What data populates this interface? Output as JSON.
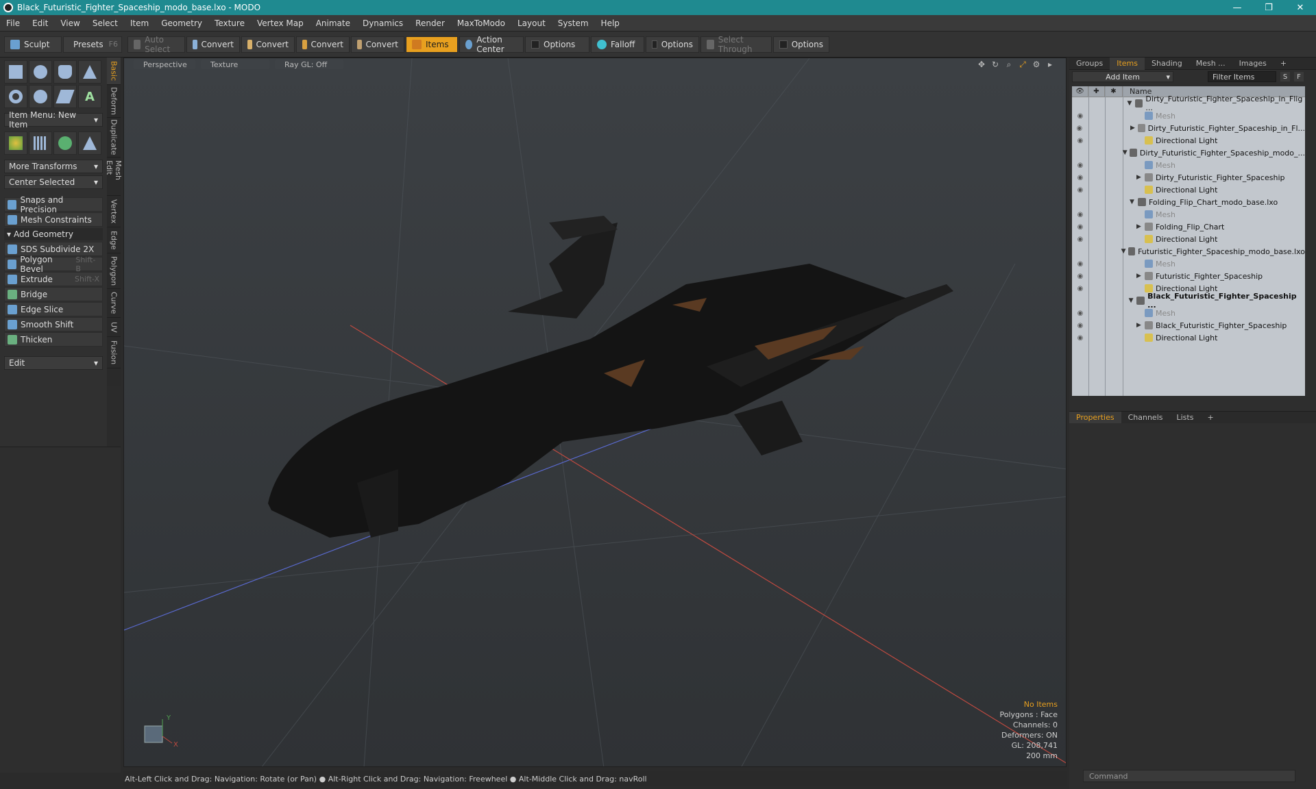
{
  "window": {
    "title": "Black_Futuristic_Fighter_Spaceship_modo_base.lxo - MODO",
    "minimize": "—",
    "maximize": "❐",
    "close": "✕"
  },
  "menu": [
    "File",
    "Edit",
    "View",
    "Select",
    "Item",
    "Geometry",
    "Texture",
    "Vertex Map",
    "Animate",
    "Dynamics",
    "Render",
    "MaxToModo",
    "Layout",
    "System",
    "Help"
  ],
  "toolbar": {
    "sculpt": "Sculpt",
    "presets": "Presets",
    "presets_key": "F6",
    "auto_select": "Auto Select",
    "convert1": "Convert",
    "convert2": "Convert",
    "convert3": "Convert",
    "convert4": "Convert",
    "items": "Items",
    "action_center": "Action Center",
    "options1": "Options",
    "falloff": "Falloff",
    "options2": "Options",
    "select_through": "Select Through",
    "options3": "Options"
  },
  "left": {
    "item_menu": "Item Menu: New Item",
    "more_transforms": "More Transforms",
    "center_selected": "Center Selected",
    "snaps": "Snaps and Precision",
    "mesh_constraints": "Mesh Constraints",
    "add_geometry": "Add Geometry",
    "tools": [
      {
        "label": "SDS Subdivide 2X",
        "key": ""
      },
      {
        "label": "Polygon Bevel",
        "key": "Shift-B"
      },
      {
        "label": "Extrude",
        "key": "Shift-X"
      },
      {
        "label": "Bridge",
        "key": ""
      },
      {
        "label": "Edge Slice",
        "key": ""
      },
      {
        "label": "Smooth Shift",
        "key": ""
      },
      {
        "label": "Thicken",
        "key": ""
      }
    ],
    "edit": "Edit",
    "vtabs": [
      "Basic",
      "Deform",
      "Duplicate",
      "Mesh Edit",
      "Vertex",
      "Edge",
      "Polygon",
      "Curve",
      "UV",
      "Fusion"
    ]
  },
  "viewport": {
    "tabs": [
      "Perspective",
      "Texture",
      "Ray GL: Off"
    ],
    "stats": {
      "no_items": "No Items",
      "polygons": "Polygons : Face",
      "channels": "Channels: 0",
      "deformers": "Deformers: ON",
      "gl": "GL: 208,741",
      "scale": "200 mm"
    },
    "axis_y": "Y",
    "axis_x": "X"
  },
  "statusbar": "Alt-Left Click and Drag: Navigation: Rotate (or Pan) ● Alt-Right Click and Drag: Navigation: Freewheel ● Alt-Middle Click and Drag: navRoll",
  "right": {
    "tabs": [
      "Groups",
      "Items",
      "Shading",
      "Mesh ...",
      "Images"
    ],
    "add_item": "Add Item",
    "filter_items": "Filter Items",
    "s": "S",
    "f": "F",
    "name_col": "Name",
    "tree": [
      {
        "label": "Dirty_Futuristic_Fighter_Spaceship_in_Flig ...",
        "depth": 0,
        "kind": "scene",
        "dim": false,
        "bold": false,
        "toggle": "▼"
      },
      {
        "label": "Mesh",
        "depth": 1,
        "kind": "mesh",
        "dim": true,
        "bold": false,
        "toggle": ""
      },
      {
        "label": "Dirty_Futuristic_Fighter_Spaceship_in_Fl...",
        "depth": 1,
        "kind": "group",
        "dim": false,
        "bold": false,
        "toggle": "▶"
      },
      {
        "label": "Directional Light",
        "depth": 1,
        "kind": "light",
        "dim": false,
        "bold": false,
        "toggle": ""
      },
      {
        "label": "Dirty_Futuristic_Fighter_Spaceship_modo_...",
        "depth": 0,
        "kind": "scene",
        "dim": false,
        "bold": false,
        "toggle": "▼"
      },
      {
        "label": "Mesh",
        "depth": 1,
        "kind": "mesh",
        "dim": true,
        "bold": false,
        "toggle": ""
      },
      {
        "label": "Dirty_Futuristic_Fighter_Spaceship",
        "depth": 1,
        "kind": "group",
        "dim": false,
        "bold": false,
        "toggle": "▶"
      },
      {
        "label": "Directional Light",
        "depth": 1,
        "kind": "light",
        "dim": false,
        "bold": false,
        "toggle": ""
      },
      {
        "label": "Folding_Flip_Chart_modo_base.lxo",
        "depth": 0,
        "kind": "scene",
        "dim": false,
        "bold": false,
        "toggle": "▼"
      },
      {
        "label": "Mesh",
        "depth": 1,
        "kind": "mesh",
        "dim": true,
        "bold": false,
        "toggle": ""
      },
      {
        "label": "Folding_Flip_Chart",
        "depth": 1,
        "kind": "group",
        "dim": false,
        "bold": false,
        "toggle": "▶"
      },
      {
        "label": "Directional Light",
        "depth": 1,
        "kind": "light",
        "dim": false,
        "bold": false,
        "toggle": ""
      },
      {
        "label": "Futuristic_Fighter_Spaceship_modo_base.lxo",
        "depth": 0,
        "kind": "scene",
        "dim": false,
        "bold": false,
        "toggle": "▼"
      },
      {
        "label": "Mesh",
        "depth": 1,
        "kind": "mesh",
        "dim": true,
        "bold": false,
        "toggle": ""
      },
      {
        "label": "Futuristic_Fighter_Spaceship",
        "depth": 1,
        "kind": "group",
        "dim": false,
        "bold": false,
        "toggle": "▶"
      },
      {
        "label": "Directional Light",
        "depth": 1,
        "kind": "light",
        "dim": false,
        "bold": false,
        "toggle": ""
      },
      {
        "label": "Black_Futuristic_Fighter_Spaceship ...",
        "depth": 0,
        "kind": "scene",
        "dim": false,
        "bold": true,
        "toggle": "▼"
      },
      {
        "label": "Mesh",
        "depth": 1,
        "kind": "mesh",
        "dim": true,
        "bold": false,
        "toggle": ""
      },
      {
        "label": "Black_Futuristic_Fighter_Spaceship",
        "depth": 1,
        "kind": "group",
        "dim": false,
        "bold": false,
        "toggle": "▶"
      },
      {
        "label": "Directional Light",
        "depth": 1,
        "kind": "light",
        "dim": false,
        "bold": false,
        "toggle": ""
      }
    ],
    "props_tabs": [
      "Properties",
      "Channels",
      "Lists"
    ],
    "command_placeholder": "Command"
  },
  "colors": {
    "accent": "#e8a01f",
    "titlebar": "#1f8a90"
  }
}
